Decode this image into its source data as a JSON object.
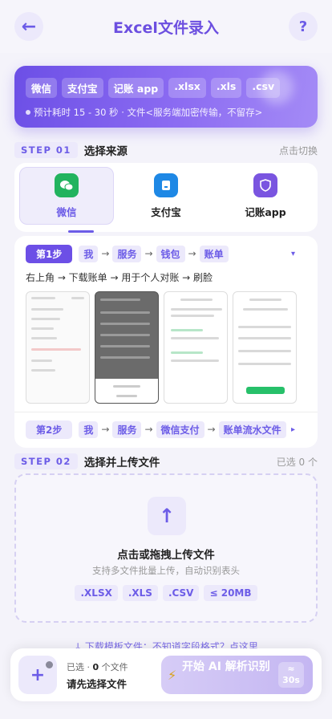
{
  "header": {
    "title": "Excel文件录入",
    "back_icon": "←",
    "help_icon": "?"
  },
  "banner": {
    "chips": [
      "微信",
      "支付宝",
      "记账 app",
      ".xlsx",
      ".xls",
      ".csv"
    ],
    "note": "预计耗时 15 - 30 秒 · 文件<服务端加密传输，不留存>"
  },
  "step1": {
    "tag": "STEP 01",
    "title": "选择来源",
    "action": "点击切换"
  },
  "sources": [
    {
      "label": "微信",
      "color": "#22b35e",
      "glyph": "◔",
      "active": true
    },
    {
      "label": "支付宝",
      "color": "#1e88e5",
      "glyph": "▣",
      "active": false
    },
    {
      "label": "记账app",
      "color": "#7a55e0",
      "glyph": "◇",
      "active": false
    }
  ],
  "guide": {
    "first": {
      "badge": "第1步",
      "path": [
        "我",
        "服务",
        "钱包",
        "账单"
      ],
      "caret": "▾",
      "description": "右上角 → 下载账单 → 用于个人对账 → 刷脸"
    },
    "second": {
      "badge": "第2步",
      "path": [
        "我",
        "服务",
        "微信支付",
        "账单流水文件"
      ],
      "caret": "▸"
    },
    "arrow": "→"
  },
  "step2": {
    "tag": "STEP 02",
    "title": "选择并上传文件",
    "status": "已选 0 个"
  },
  "upload": {
    "icon": "↑",
    "title": "点击或拖拽上传文件",
    "subtitle": "支持多文件批量上传，自动识别表头",
    "formats": [
      ".XLSX",
      ".XLS",
      ".CSV",
      "≤ 20MB"
    ]
  },
  "template_link": "↓ 下载模板文件：不知道字段格式？点这里",
  "bottom": {
    "add_icon": "+",
    "selected_prefix": "已选 · ",
    "selected_count": "0",
    "selected_suffix": " 个文件",
    "hint": "请先选择文件",
    "ai_label": "开始 AI 解析识别",
    "eta": "≈ 30s",
    "bolt_icon": "⚡"
  }
}
